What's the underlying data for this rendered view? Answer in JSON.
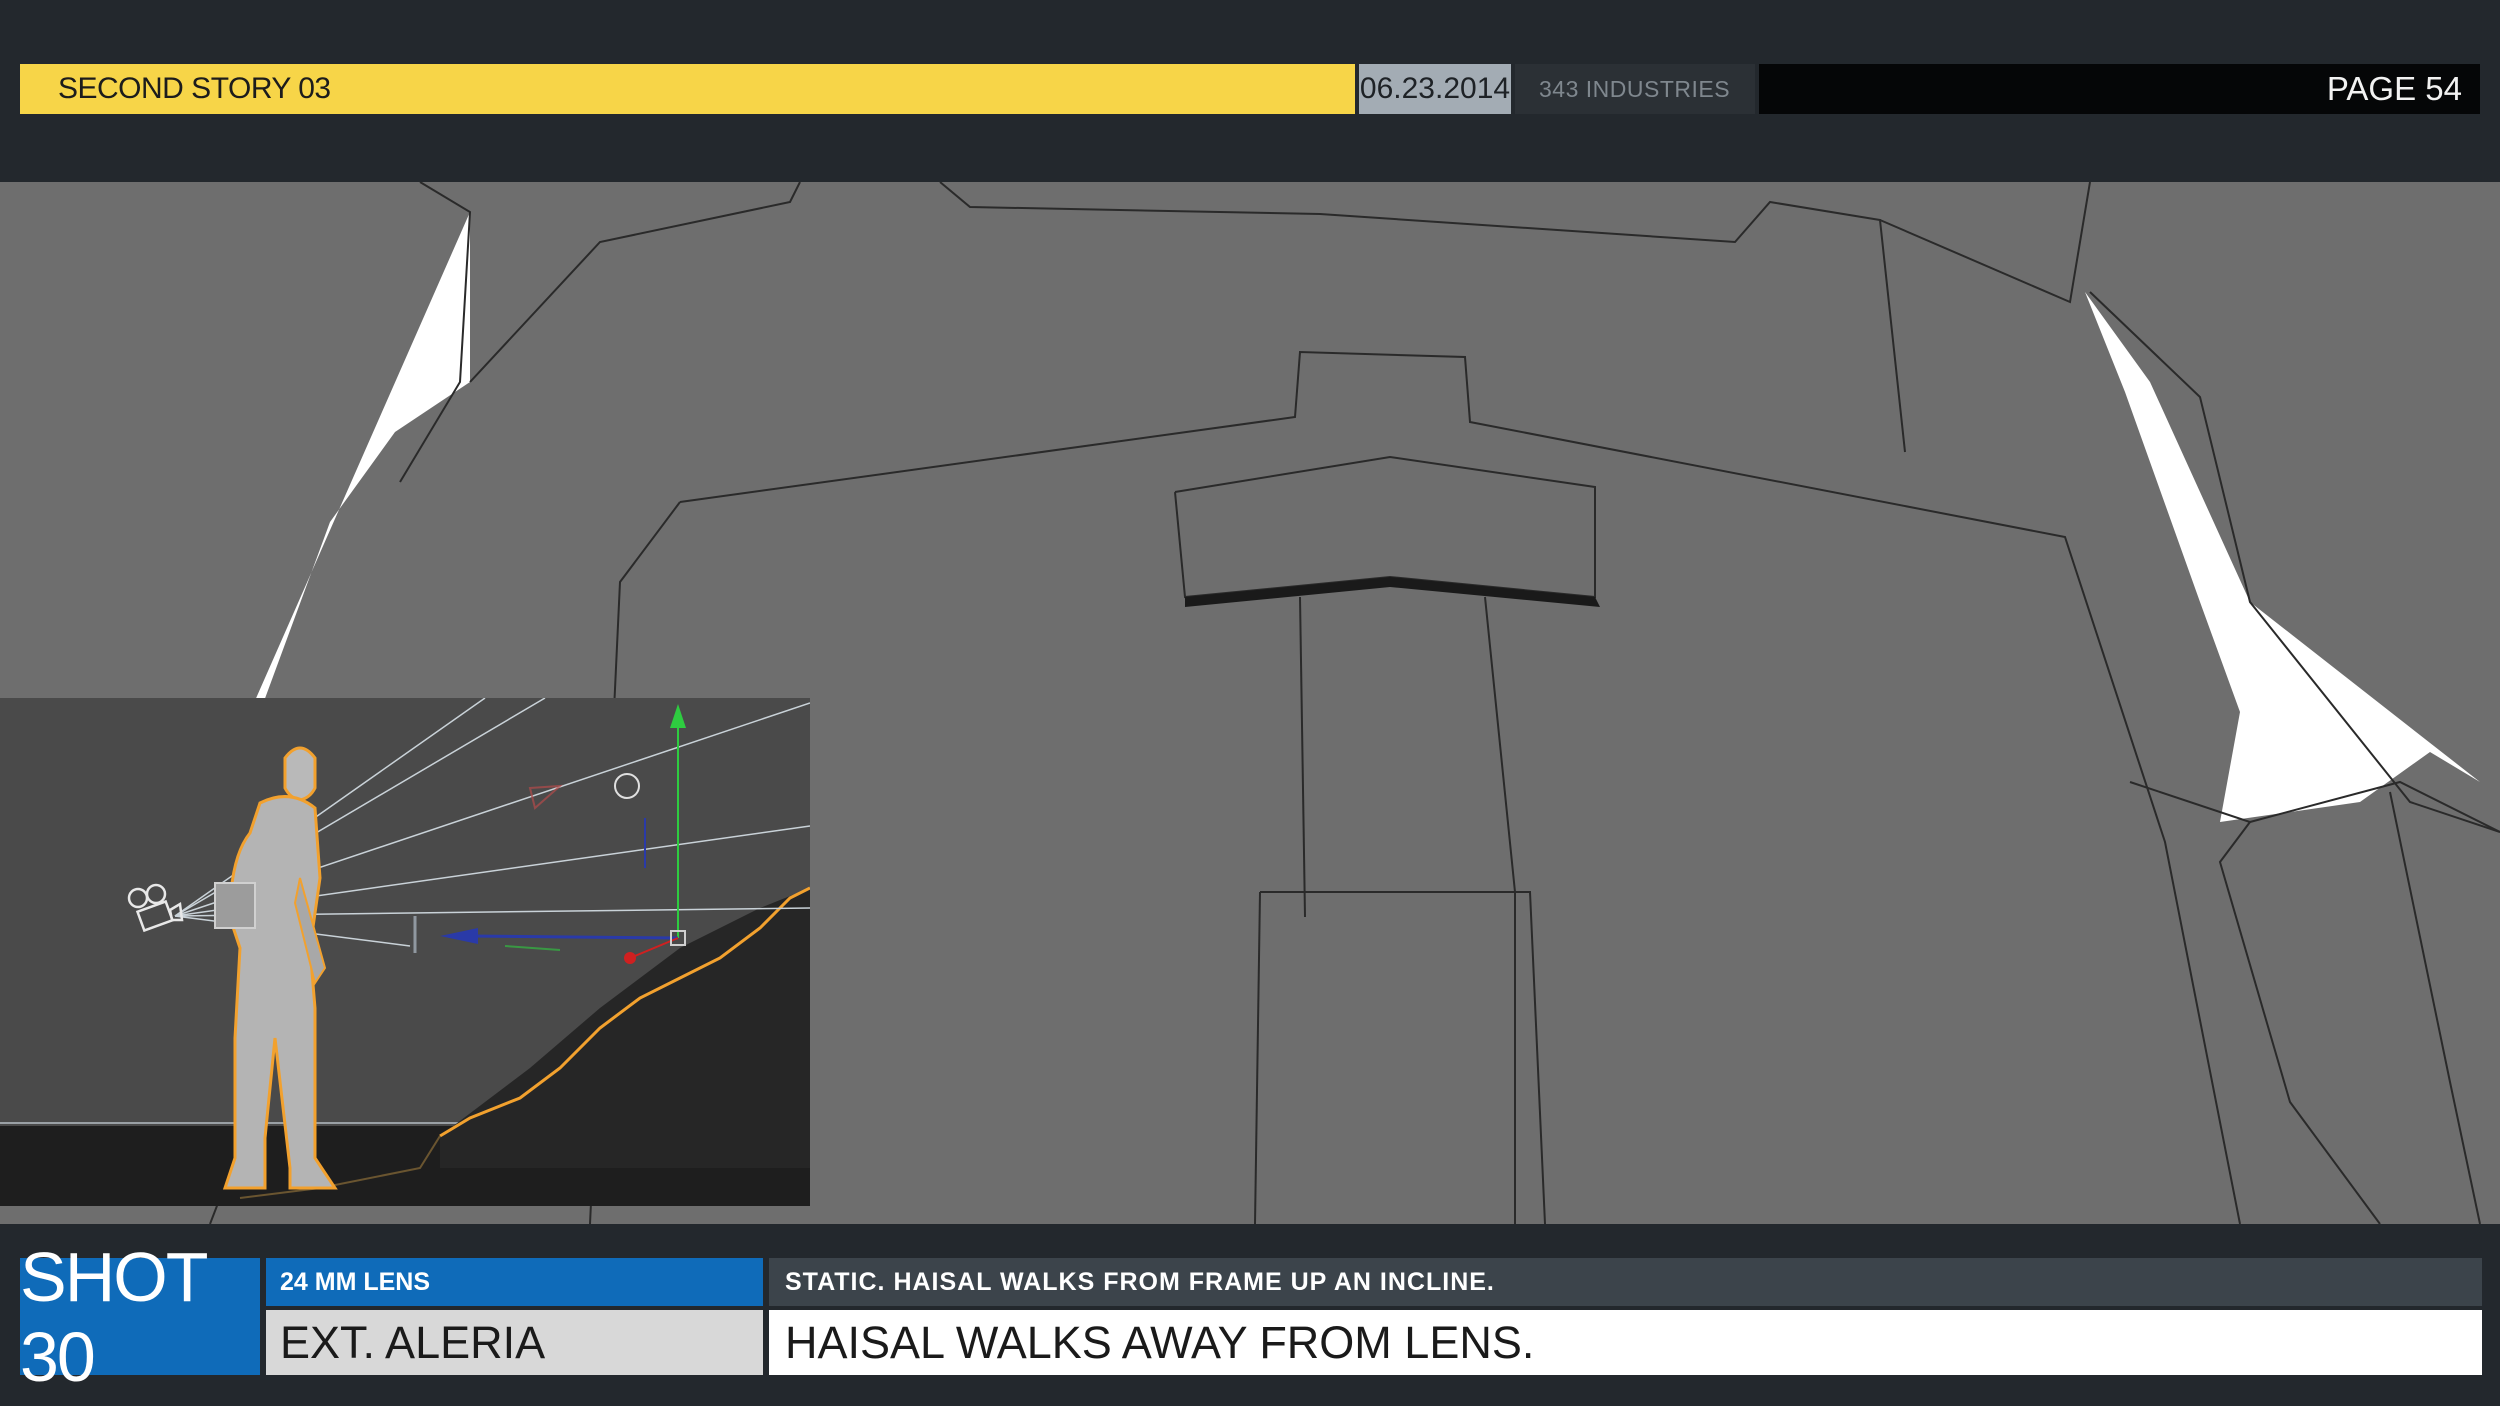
{
  "header": {
    "title": "SECOND STORY 03",
    "date": "06.23.2014",
    "studio": "343 INDUSTRIES",
    "page": "PAGE 54"
  },
  "footer": {
    "shot": "SHOT 30",
    "lens": "24 MM LENS",
    "location": "EXT.  ALERIA",
    "description": "STATIC.  HAISAL WALKS FROM FRAME UP AN INCLINE.",
    "action": "HAISAL WALKS AWAY FROM LENS."
  },
  "colors": {
    "header_yellow": "#f7d548",
    "shot_blue": "#0f6bb9",
    "background": "#23282d",
    "selection_orange": "#f2a12e"
  },
  "icons": {
    "camera": "camera-icon",
    "move_gizmo": "move-gizmo-icon",
    "light": "light-icon"
  }
}
